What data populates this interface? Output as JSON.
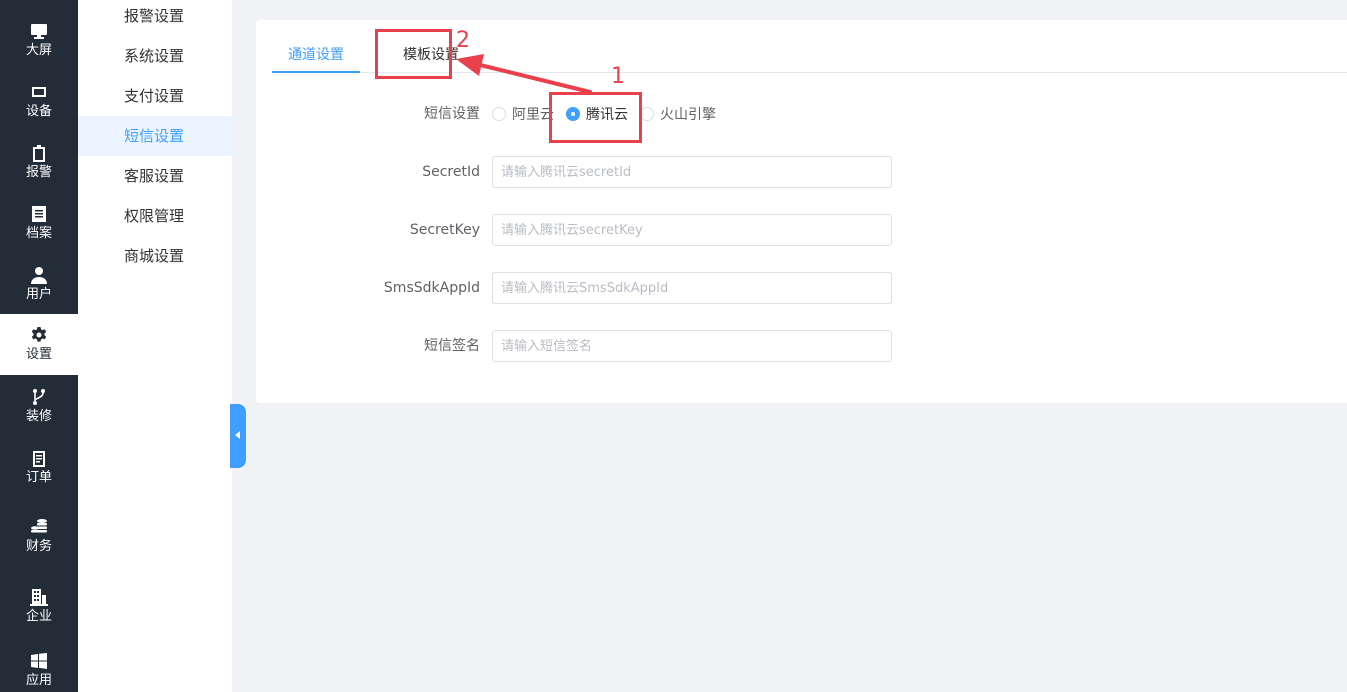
{
  "rail": {
    "items": [
      {
        "label": "大屏",
        "icon": "monitor-icon"
      },
      {
        "label": "设备",
        "icon": "device-icon"
      },
      {
        "label": "报警",
        "icon": "clipboard-icon"
      },
      {
        "label": "档案",
        "icon": "file-icon"
      },
      {
        "label": "用户",
        "icon": "user-icon"
      },
      {
        "label": "设置",
        "icon": "gear-icon",
        "active": true
      },
      {
        "label": "装修",
        "icon": "branch-icon"
      },
      {
        "label": "订单",
        "icon": "order-icon"
      },
      {
        "label": "财务",
        "icon": "coins-icon"
      },
      {
        "label": "企业",
        "icon": "building-icon"
      },
      {
        "label": "应用",
        "icon": "windows-icon"
      }
    ]
  },
  "submenu": {
    "items": [
      "报警设置",
      "系统设置",
      "支付设置",
      "短信设置",
      "客服设置",
      "权限管理",
      "商城设置"
    ],
    "active": "短信设置"
  },
  "tabs": {
    "channel": "通道设置",
    "template": "模板设置"
  },
  "form": {
    "sms_provider_label": "短信设置",
    "providers": [
      "阿里云",
      "腾讯云",
      "火山引擎"
    ],
    "selected_provider": "腾讯云",
    "secret_id_label": "SecretId",
    "secret_id_placeholder": "请输入腾讯云secretId",
    "secret_key_label": "SecretKey",
    "secret_key_placeholder": "请输入腾讯云secretKey",
    "app_id_label": "SmsSdkAppId",
    "app_id_placeholder": "请输入腾讯云SmsSdkAppId",
    "sign_label": "短信签名",
    "sign_placeholder": "请输入短信签名"
  },
  "annotations": {
    "step1": "1",
    "step2": "2"
  },
  "colors": {
    "rail_bg": "#222d38",
    "accent": "#409eff",
    "annotation": "#e8414b"
  }
}
